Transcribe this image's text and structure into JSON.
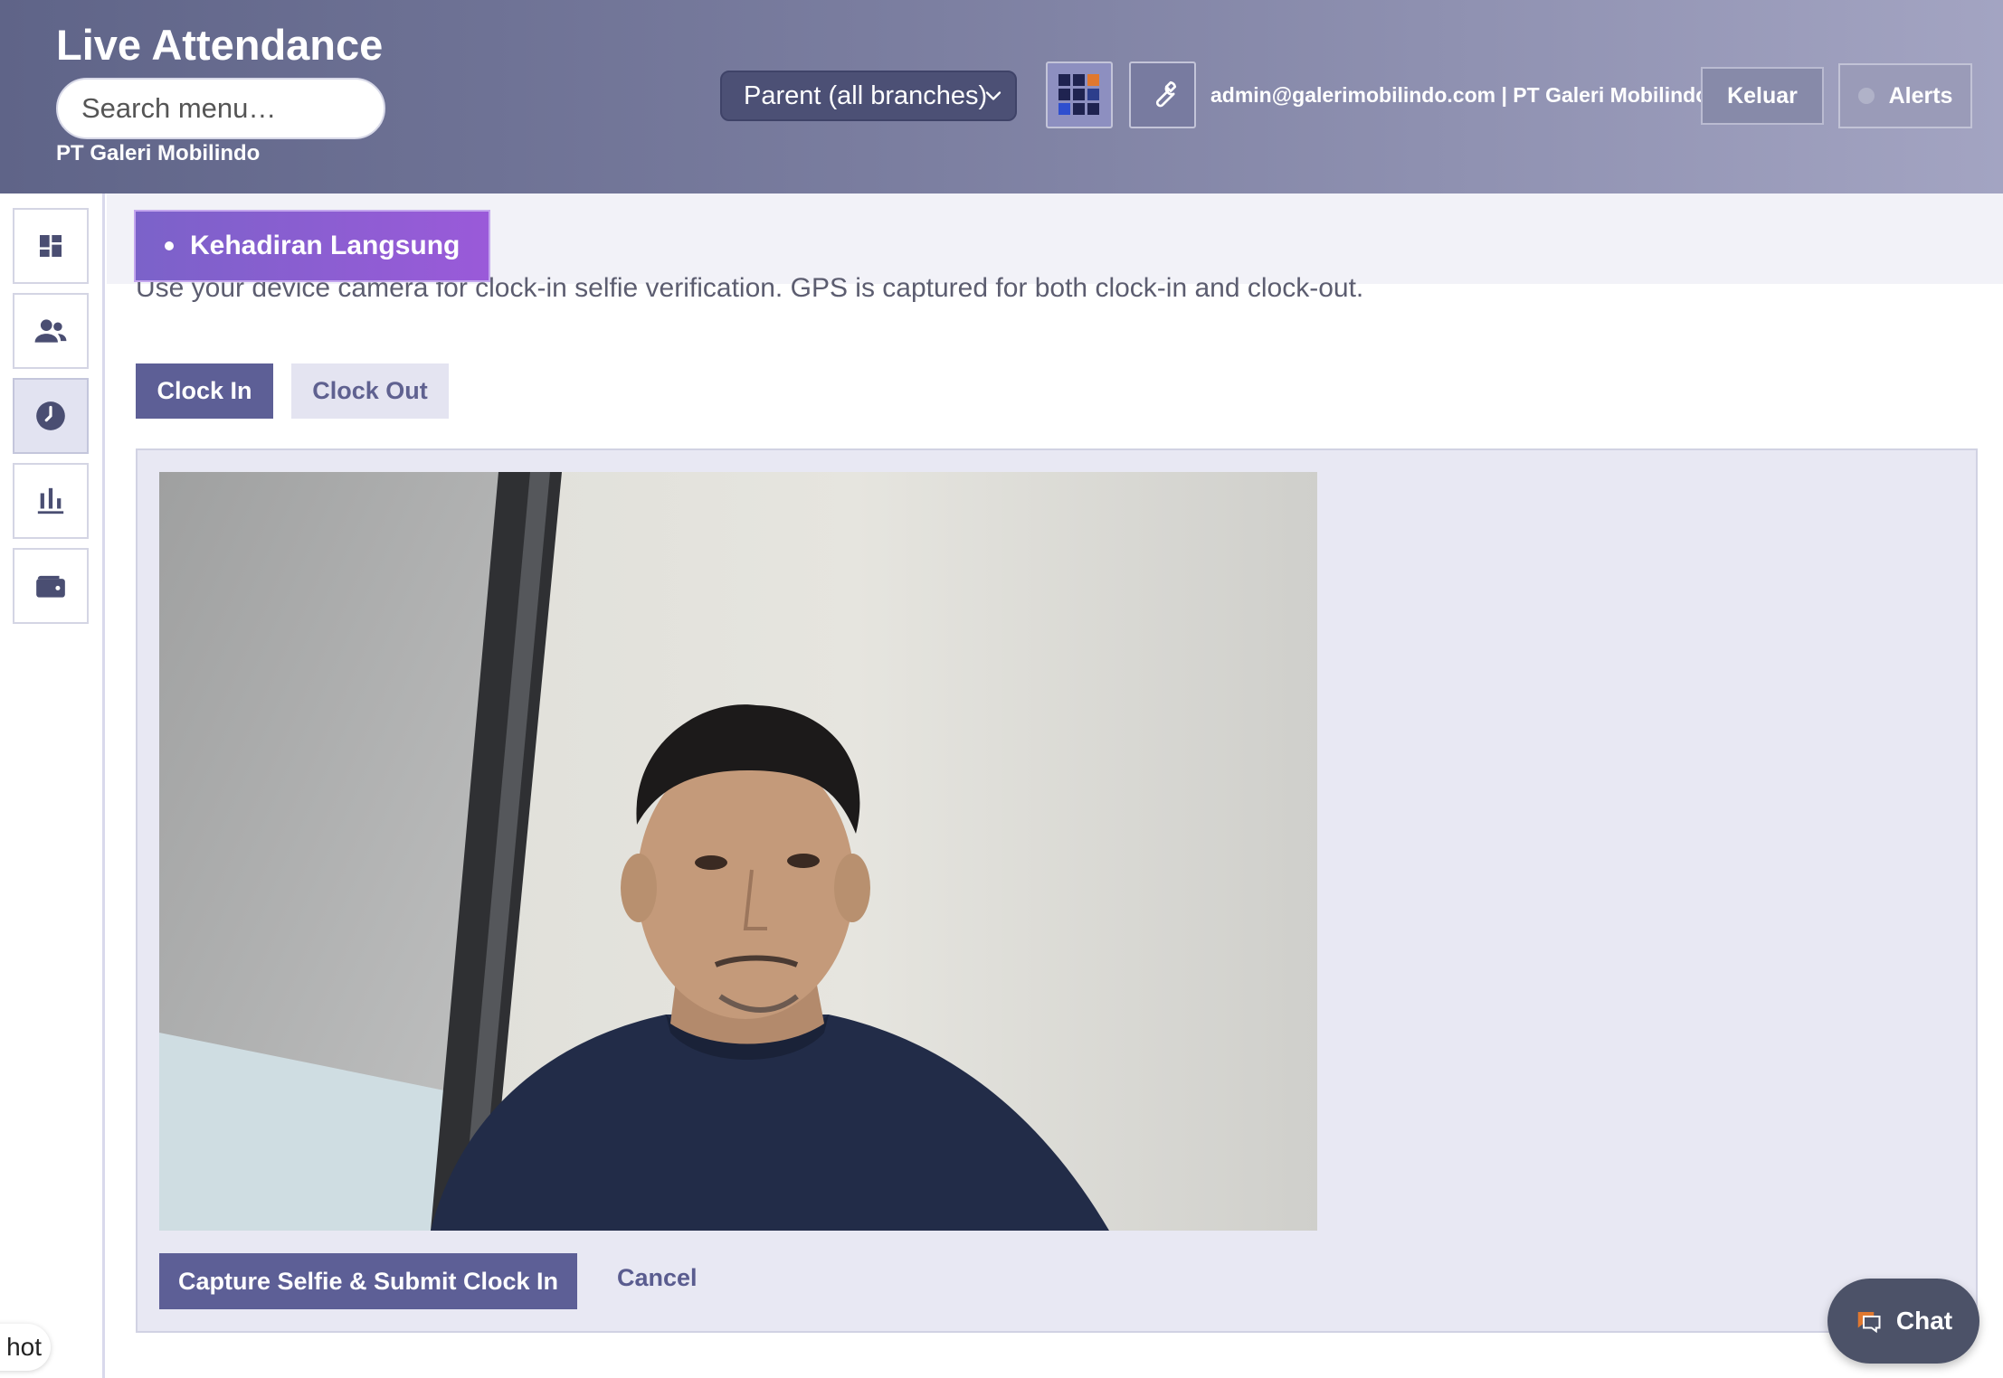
{
  "header": {
    "title": "Live Attendance",
    "search_placeholder": "Search menu…",
    "company": "PT Galeri Mobilindo",
    "branch_select": "Parent (all branches)",
    "apps_icon": "grid-apps-icon",
    "tools_icon": "wrench-icon",
    "user": "admin@galerimobilindo.com | PT Galeri Mobilindo",
    "logout_label": "Keluar",
    "alerts_label": "Alerts"
  },
  "sidebar": {
    "items": [
      {
        "icon": "dashboard-icon",
        "active": false
      },
      {
        "icon": "people-icon",
        "active": false
      },
      {
        "icon": "clock-icon",
        "active": true
      },
      {
        "icon": "bar-chart-icon",
        "active": false
      },
      {
        "icon": "wallet-icon",
        "active": false
      }
    ]
  },
  "page": {
    "tab_label": "Kehadiran Langsung",
    "description": "Use your device camera for clock-in selfie verification. GPS is captured for both clock-in and clock-out.",
    "clock_in_label": "Clock In",
    "clock_out_label": "Clock Out",
    "capture_label": "Capture Selfie & Submit Clock In",
    "cancel_label": "Cancel"
  },
  "chat": {
    "label": "Chat"
  },
  "edge_pill": {
    "label": "hot"
  },
  "colors": {
    "primary": "#5d5f96",
    "accent_purple": "#9a5ad9",
    "header_start": "#5f6488",
    "header_end": "#a3a4c2"
  }
}
